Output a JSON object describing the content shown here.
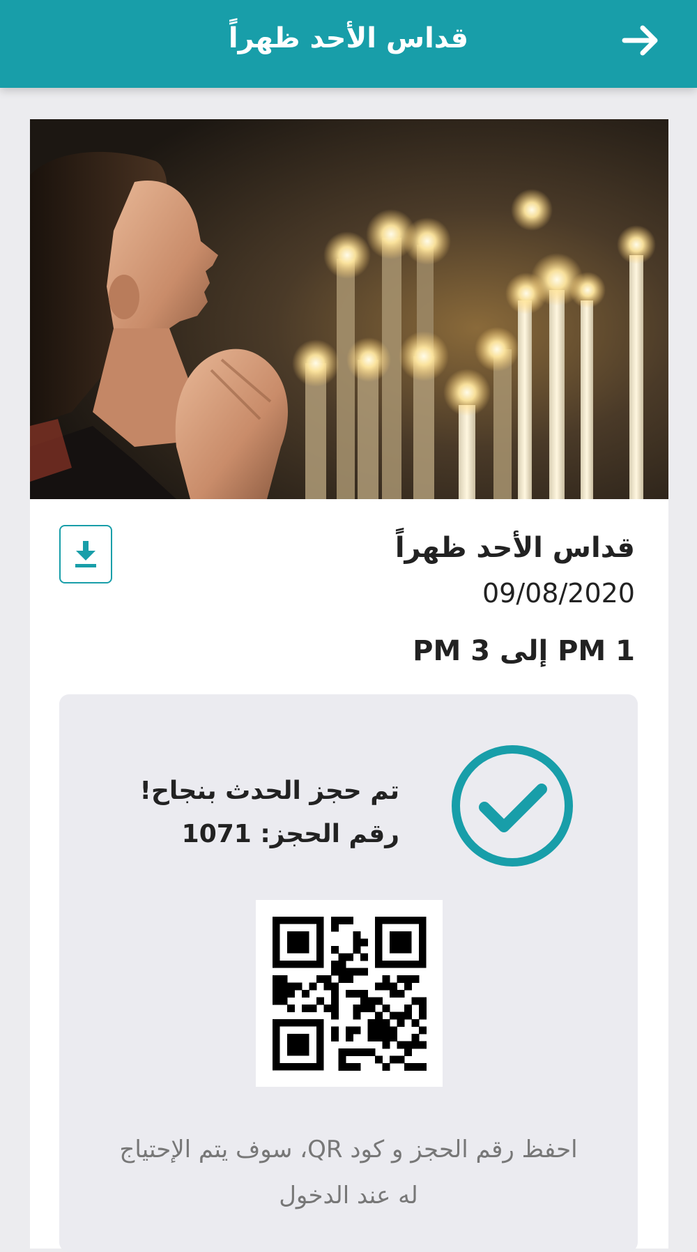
{
  "header": {
    "title": "قداس الأحد ظهراً",
    "back_icon": "arrow-right-icon"
  },
  "event": {
    "title": "قداس الأحد ظهراً",
    "date": "09/08/2020",
    "time": "PM 1 إلى PM 3",
    "download_icon": "download-icon"
  },
  "confirmation": {
    "success": "تم حجز الحدث بنجاح!",
    "booking_label": "رقم الحجز:",
    "booking_number": "1071",
    "check_icon": "check-circle-icon",
    "note": "احفظ رقم الحجز و كود QR، سوف يتم الإحتياج له عند الدخول"
  },
  "colors": {
    "accent": "#189ea9",
    "background": "#ececef",
    "panel": "#ebebf0"
  }
}
